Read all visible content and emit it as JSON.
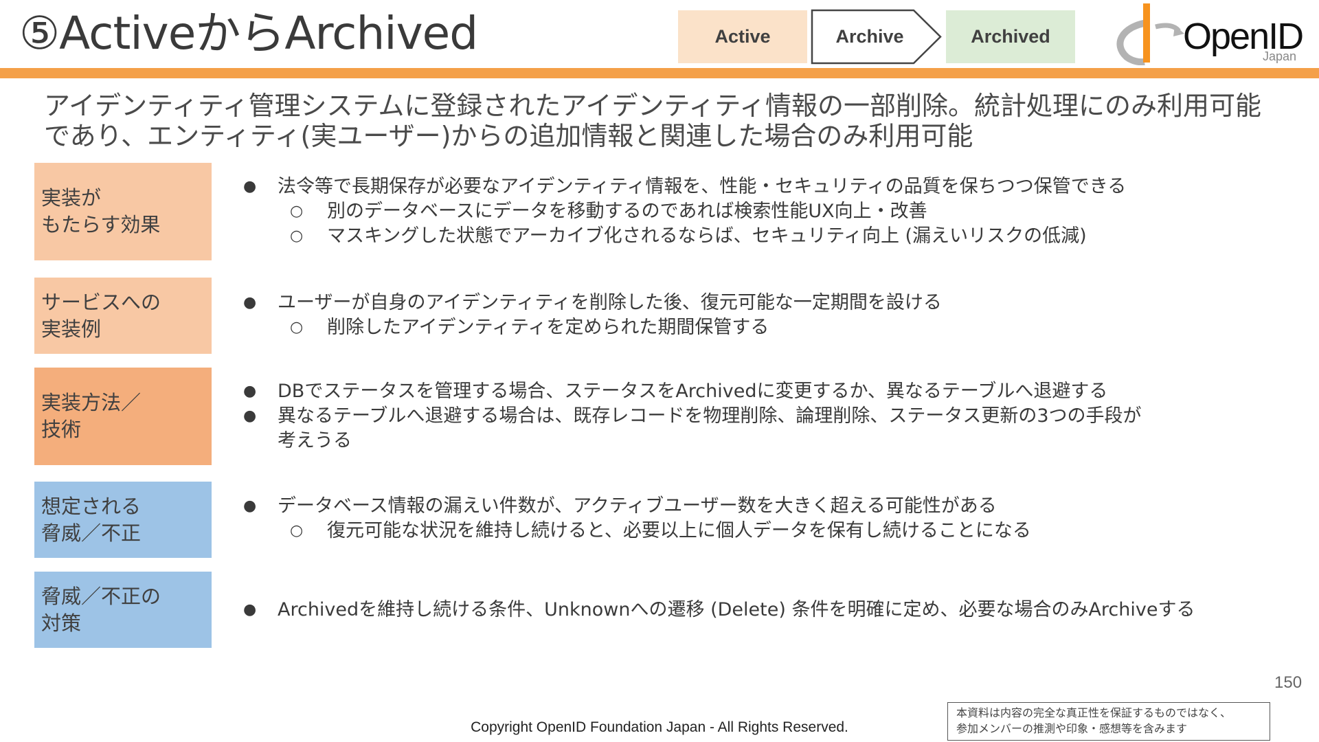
{
  "slide": {
    "title": "⑤ActiveからArchived",
    "stages": {
      "active": "Active",
      "archive": "Archive",
      "archived": "Archived"
    },
    "logo": {
      "text": "OpenID",
      "sub": "Japan",
      "icon": "openid-logo-icon"
    },
    "summary": "アイデンティティ管理システムに登録されたアイデンティティ情報の一部削除。統計処理にのみ利用可能であり、エンティティ(実ユーザー)からの追加情報と関連した場合のみ利用可能",
    "rows": [
      {
        "label": [
          "実装が",
          "もたらす効果"
        ],
        "color": "#f8c8a4",
        "items": [
          {
            "level": 1,
            "text": "法令等で長期保存が必要なアイデンティティ情報を、性能・セキュリティの品質を保ちつつ保管できる"
          },
          {
            "level": 2,
            "text": "別のデータベースにデータを移動するのであれば検索性能UX向上・改善"
          },
          {
            "level": 2,
            "text": "マスキングした状態でアーカイブ化されるならば、セキュリティ向上 (漏えいリスクの低減)"
          }
        ]
      },
      {
        "label": [
          "サービスへの",
          "実装例"
        ],
        "color": "#f8c8a4",
        "items": [
          {
            "level": 1,
            "text": "ユーザーが自身のアイデンティティを削除した後、復元可能な一定期間を設ける"
          },
          {
            "level": 2,
            "text": "削除したアイデンティティを定められた期間保管する"
          }
        ]
      },
      {
        "label": [
          "実装方法／",
          "技術"
        ],
        "color": "#f4ae7c",
        "items": [
          {
            "level": 1,
            "text": "DBでステータスを管理する場合、ステータスをArchivedに変更するか、異なるテーブルへ退避する"
          },
          {
            "level": 1,
            "text": "異なるテーブルへ退避する場合は、既存レコードを物理削除、論理削除、ステータス更新の3つの手段が考えうる"
          }
        ]
      },
      {
        "label": [
          "想定される",
          "脅威／不正"
        ],
        "color": "#9dc3e6",
        "items": [
          {
            "level": 1,
            "text": "データベース情報の漏えい件数が、アクティブユーザー数を大きく超える可能性がある"
          },
          {
            "level": 2,
            "text": "復元可能な状況を維持し続けると、必要以上に個人データを保有し続けることになる"
          }
        ]
      },
      {
        "label": [
          "脅威／不正の",
          "対策"
        ],
        "color": "#9dc3e6",
        "items": [
          {
            "level": 1,
            "text": "Archivedを維持し続ける条件、Unknownへの遷移 (Delete) 条件を明確に定め、必要な場合のみArchiveする"
          }
        ]
      }
    ],
    "page_number": "150",
    "copyright": "Copyright OpenID Foundation Japan - All Rights Reserved.",
    "disclaimer": "本資料は内容の完全な真正性を保証するものではなく、\n参加メンバーの推測や印象・感想等を含みます"
  }
}
